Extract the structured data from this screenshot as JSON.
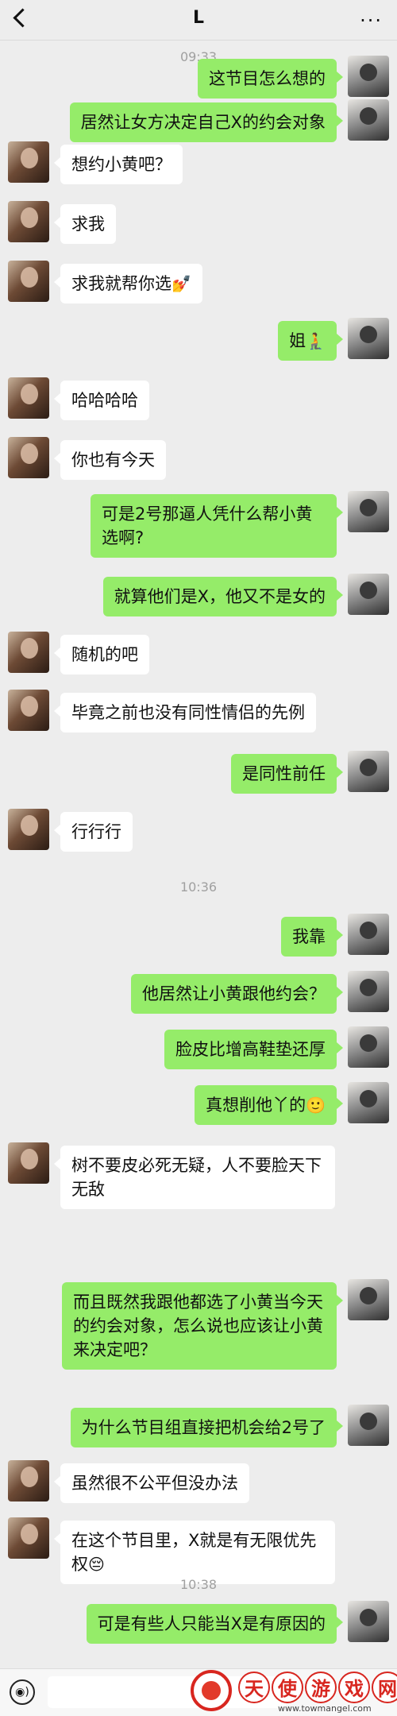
{
  "header": {
    "back_icon": "chevron-left-icon",
    "title": "L",
    "more_icon": "more-dots-icon",
    "more_label": "···"
  },
  "times": [
    "09:33",
    "10:36",
    "10:38"
  ],
  "messages": [
    {
      "side": "right",
      "text": "这节目怎么想的"
    },
    {
      "side": "right",
      "text": "居然让女方决定自己X的约会对象"
    },
    {
      "side": "left",
      "text": "想约小黄吧？"
    },
    {
      "side": "left",
      "text": "求我"
    },
    {
      "side": "left",
      "text": "求我就帮你选",
      "emoji": "💅"
    },
    {
      "side": "right",
      "text": "姐",
      "emoji": "🧎"
    },
    {
      "side": "left",
      "text": "哈哈哈哈"
    },
    {
      "side": "left",
      "text": "你也有今天"
    },
    {
      "side": "right",
      "text": "可是2号那逼人凭什么帮小黄选啊?"
    },
    {
      "side": "right",
      "text": "就算他们是X，他又不是女的"
    },
    {
      "side": "left",
      "text": "随机的吧"
    },
    {
      "side": "left",
      "text": "毕竟之前也没有同性情侣的先例"
    },
    {
      "side": "right",
      "text": "是同性前任"
    },
    {
      "side": "left",
      "text": "行行行"
    },
    {
      "side": "right",
      "text": "我靠"
    },
    {
      "side": "right",
      "text": "他居然让小黄跟他约会？"
    },
    {
      "side": "right",
      "text": "脸皮比增高鞋垫还厚"
    },
    {
      "side": "right",
      "text": "真想削他丫的",
      "emoji": "🙂"
    },
    {
      "side": "left",
      "text": "树不要皮必死无疑，人不要脸天下无敌"
    },
    {
      "side": "right",
      "text": "而且既然我跟他都选了小黄当今天的约会对象，怎么说也应该让小黄来决定吧？"
    },
    {
      "side": "right",
      "text": "为什么节目组直接把机会给2号了"
    },
    {
      "side": "left",
      "text": "虽然很不公平但没办法"
    },
    {
      "side": "left",
      "text": "在这个节目里，X就是有无限优先权",
      "emoji": "😔"
    },
    {
      "side": "right",
      "text": "可是有些人只能当X是有原因的"
    }
  ],
  "input_bar": {
    "voice_icon": "voice-icon",
    "voice_symbol": "◉)"
  },
  "watermark": {
    "chars": [
      "天",
      "使",
      "游",
      "戏",
      "网"
    ],
    "url": "www.towmangel.com",
    "brand_color": "#d8261f"
  },
  "colors": {
    "background": "#ededed",
    "bubble_self": "#95ec69",
    "bubble_other": "#ffffff"
  }
}
